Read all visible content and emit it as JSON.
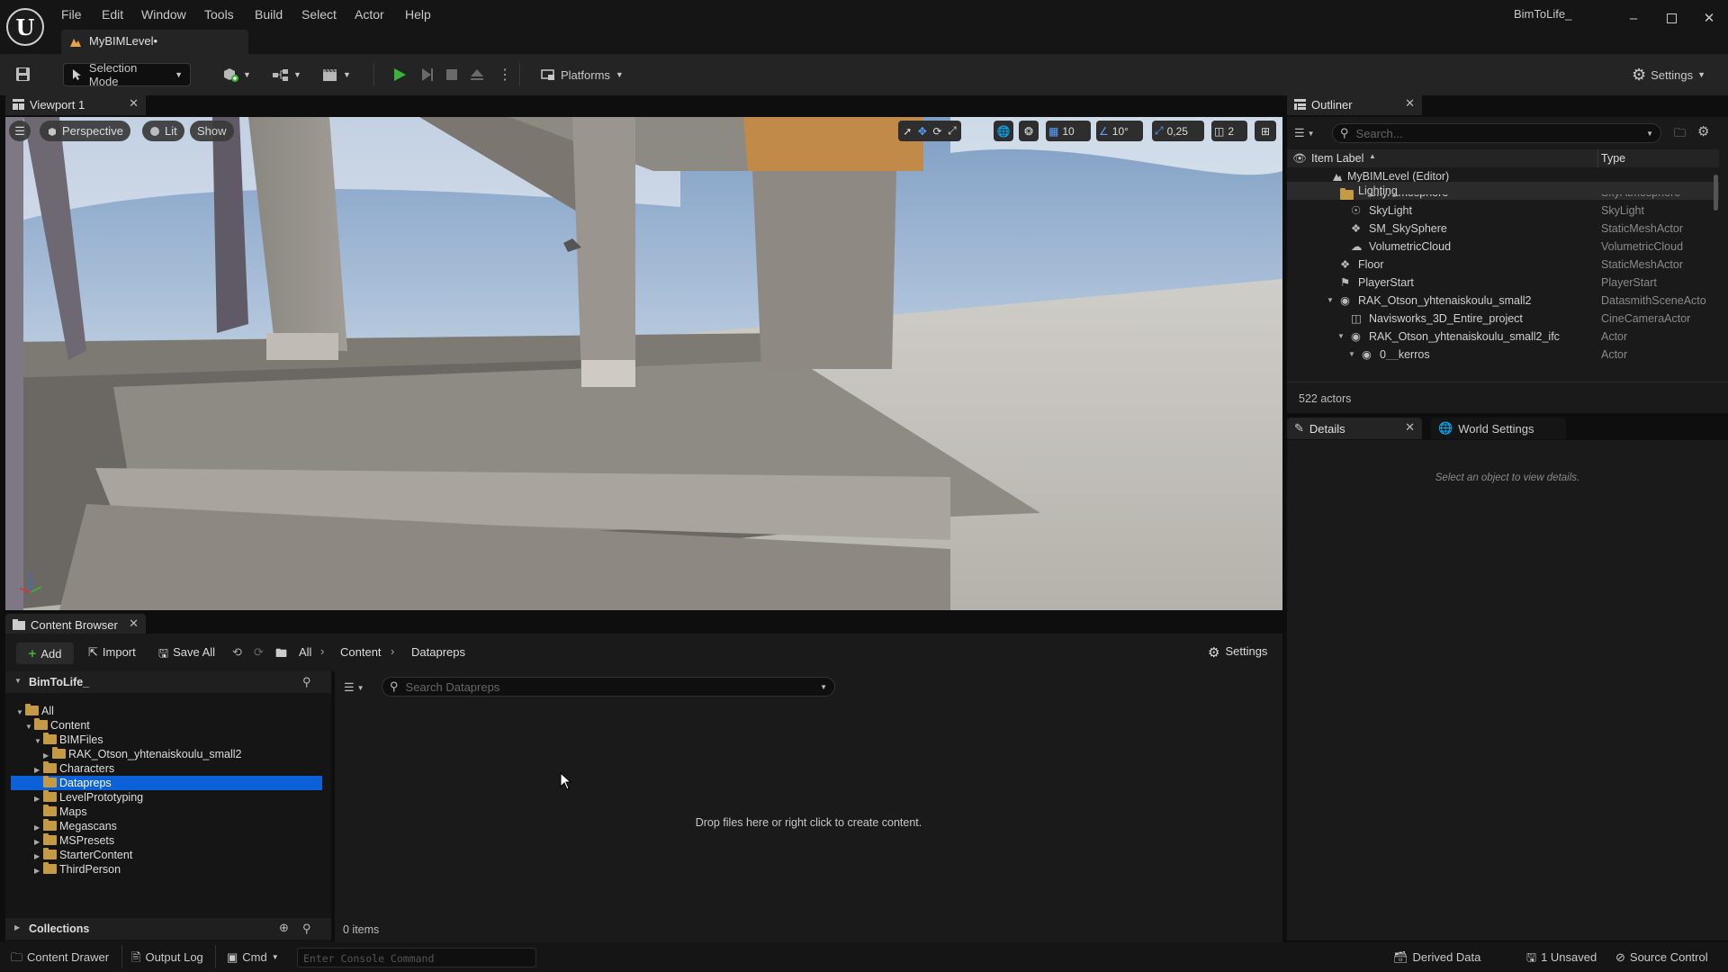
{
  "app": {
    "project_name": "BimToLife_",
    "level_tab": "MyBIMLevel•",
    "menu": [
      "File",
      "Edit",
      "Window",
      "Tools",
      "Build",
      "Select",
      "Actor",
      "Help"
    ],
    "colors": {
      "accent": "#0c60d8",
      "play": "#3bb33b",
      "folder": "#c59a45",
      "panel": "#1a1a1a",
      "warning": "#e8a34a"
    }
  },
  "toolbar": {
    "selection_mode": "Selection Mode",
    "platforms": "Platforms",
    "settings": "Settings"
  },
  "viewport": {
    "tab_title": "Viewport 1",
    "perspective": "Perspective",
    "lit": "Lit",
    "show": "Show",
    "grid_snap": "10",
    "rotate_snap": "10°",
    "scale_snap": "0,25",
    "camera_speed": "2"
  },
  "outliner": {
    "tab_title": "Outliner",
    "search_placeholder": "Search...",
    "col_label": "Item Label",
    "col_type": "Type",
    "partial_top_label": "SkyAtmosphere",
    "partial_top_type": "SkyAtmosphere",
    "rows": [
      {
        "label": "MyBIMLevel (Editor)",
        "type": "",
        "icon": "level-icon"
      },
      {
        "label": "Lighting",
        "type": "",
        "icon": "folder-icon"
      },
      {
        "label": "SkyLight",
        "type": "SkyLight",
        "icon": "skylight-icon"
      },
      {
        "label": "SM_SkySphere",
        "type": "StaticMeshActor",
        "icon": "static-mesh-icon"
      },
      {
        "label": "VolumetricCloud",
        "type": "VolumetricCloud",
        "icon": "cloud-icon"
      },
      {
        "label": "Floor",
        "type": "StaticMeshActor",
        "icon": "static-mesh-icon"
      },
      {
        "label": "PlayerStart",
        "type": "PlayerStart",
        "icon": "player-start-icon"
      },
      {
        "label": "RAK_Otson_yhtenaiskoulu_small2",
        "type": "DatasmithSceneActo",
        "icon": "actor-icon"
      },
      {
        "label": "Navisworks_3D_Entire_project",
        "type": "CineCameraActor",
        "icon": "camera-icon"
      },
      {
        "label": "RAK_Otson_yhtenaiskoulu_small2_ifc",
        "type": "Actor",
        "icon": "actor-icon"
      },
      {
        "label": "0__kerros",
        "type": "Actor",
        "icon": "actor-icon"
      }
    ],
    "actor_count": "522 actors"
  },
  "details": {
    "tab_title": "Details",
    "world_settings": "World Settings",
    "empty_message": "Select an object to view details."
  },
  "content_browser": {
    "tab_title": "Content Browser",
    "add": "Add",
    "import": "Import",
    "save_all": "Save All",
    "breadcrumb": [
      "All",
      "Content",
      "Datapreps"
    ],
    "settings": "Settings",
    "root": "BimToLife_",
    "tree": [
      {
        "label": "All"
      },
      {
        "label": "Content"
      },
      {
        "label": "BIMFiles"
      },
      {
        "label": "RAK_Otson_yhtenaiskoulu_small2"
      },
      {
        "label": "Characters"
      },
      {
        "label": "Datapreps"
      },
      {
        "label": "LevelPrototyping"
      },
      {
        "label": "Maps"
      },
      {
        "label": "Megascans"
      },
      {
        "label": "MSPresets"
      },
      {
        "label": "StarterContent"
      },
      {
        "label": "ThirdPerson"
      }
    ],
    "collections": "Collections",
    "search_placeholder": "Search Datapreps",
    "empty_message": "Drop files here or right click to create content.",
    "item_count": "0 items"
  },
  "statusbar": {
    "content_drawer": "Content Drawer",
    "output_log": "Output Log",
    "cmd": "Cmd",
    "console_placeholder": "Enter Console Command",
    "derived_data": "Derived Data",
    "unsaved": "1 Unsaved",
    "source_control": "Source Control"
  }
}
